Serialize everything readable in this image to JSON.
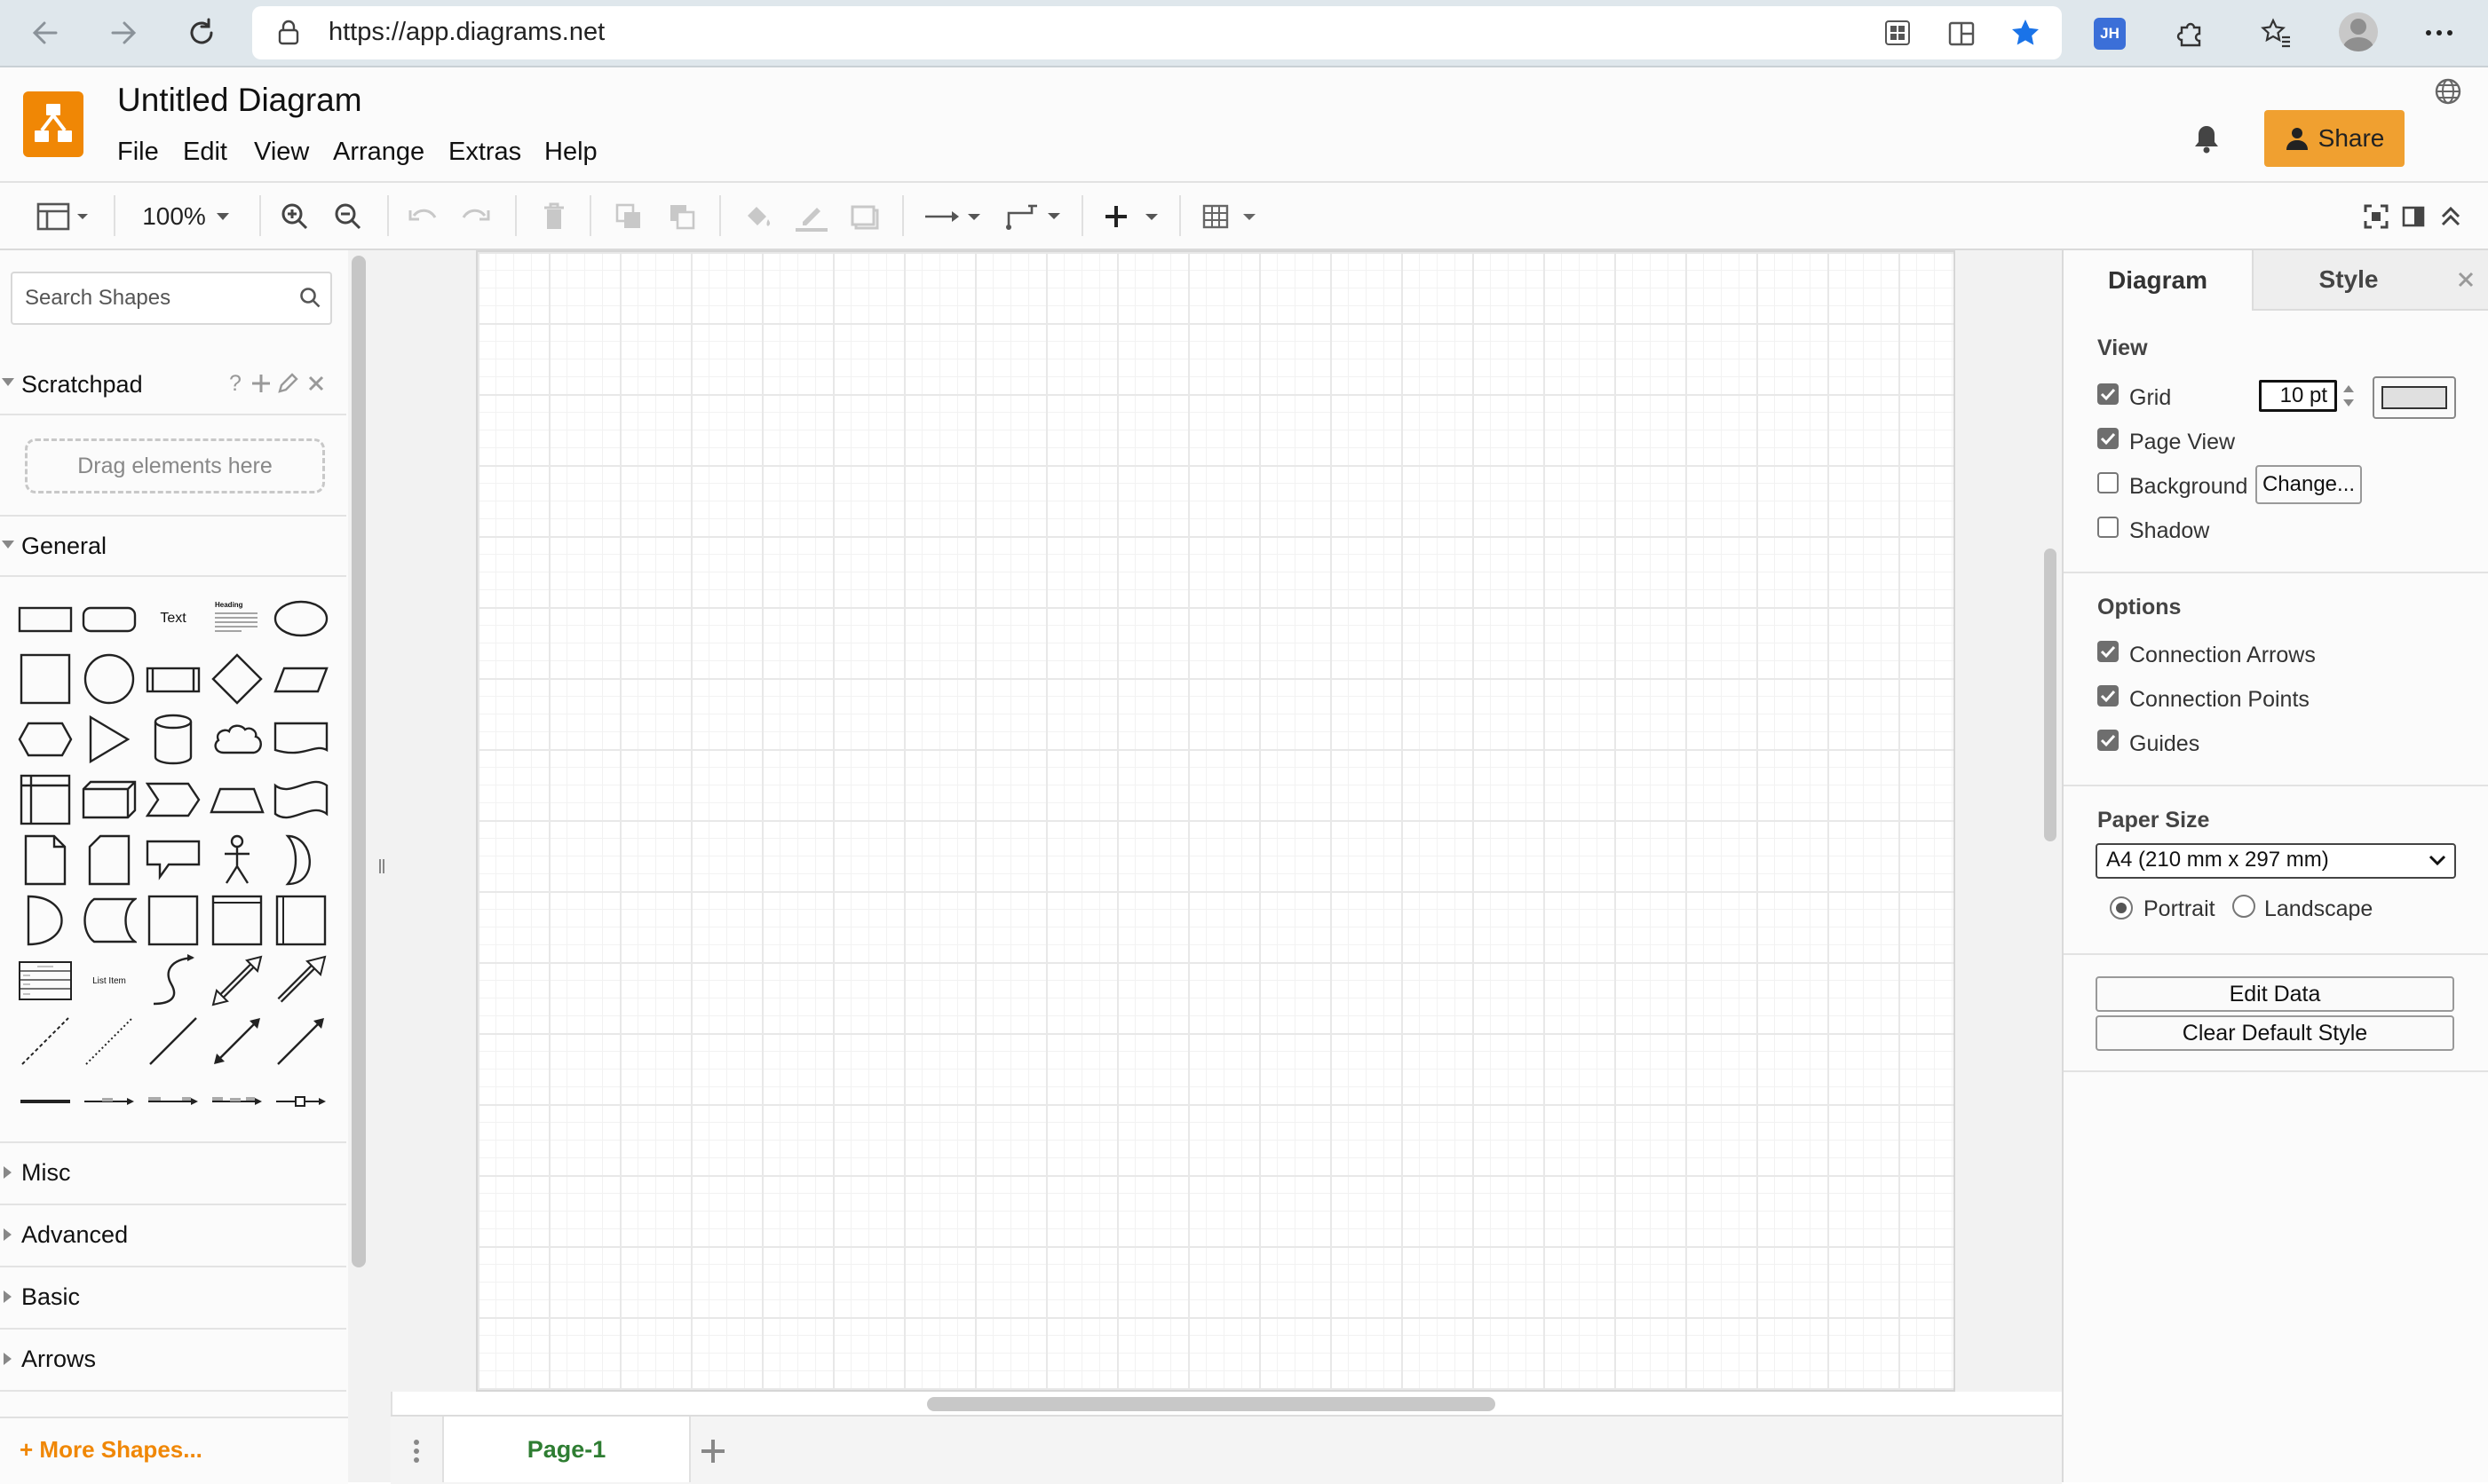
{
  "browser": {
    "url": "https://app.diagrams.net",
    "profile_initials": "JH"
  },
  "app": {
    "title": "Untitled Diagram",
    "menus": [
      "File",
      "Edit",
      "View",
      "Arrange",
      "Extras",
      "Help"
    ],
    "share_label": "Share",
    "brand_color": "#f08705"
  },
  "toolbar": {
    "zoom": "100%"
  },
  "left_panel": {
    "search_placeholder": "Search Shapes",
    "scratchpad_title": "Scratchpad",
    "scratchpad_help": "?",
    "drop_hint": "Drag elements here",
    "general_title": "General",
    "shape_text_label": "Text",
    "shape_heading_label": "Heading",
    "shape_list_item_label": "List Item",
    "sections": [
      "Misc",
      "Advanced",
      "Basic",
      "Arrows"
    ],
    "more_shapes": "+ More Shapes..."
  },
  "pages": {
    "active": "Page-1"
  },
  "right_panel": {
    "tabs": [
      "Diagram",
      "Style"
    ],
    "view_heading": "View",
    "grid_label": "Grid",
    "grid_checked": true,
    "grid_size": "10 pt",
    "page_view_label": "Page View",
    "page_view_checked": true,
    "background_label": "Background",
    "background_checked": false,
    "change_button": "Change...",
    "shadow_label": "Shadow",
    "shadow_checked": false,
    "options_heading": "Options",
    "connection_arrows": "Connection Arrows",
    "connection_points": "Connection Points",
    "guides": "Guides",
    "paper_size_heading": "Paper Size",
    "paper_size_value": "A4 (210 mm x 297 mm)",
    "portrait": "Portrait",
    "landscape": "Landscape",
    "orientation_selected": "Portrait",
    "edit_data": "Edit Data",
    "clear_default_style": "Clear Default Style"
  }
}
